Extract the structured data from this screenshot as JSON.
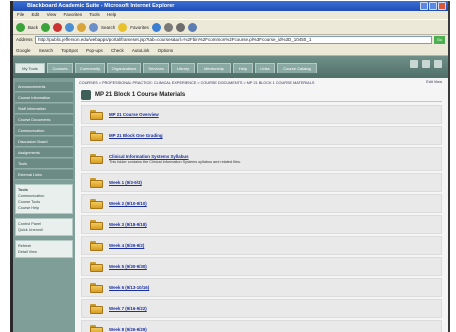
{
  "window": {
    "title": "Blackboard Academic Suite - Microsoft Internet Explorer"
  },
  "menu": [
    "File",
    "Edit",
    "View",
    "Favorites",
    "Tools",
    "Help"
  ],
  "toolbar": {
    "back": "Back",
    "search": "Search",
    "favorites": "Favorites"
  },
  "address": {
    "label": "Address",
    "url": "http://public.jefferson.edu/webapps/portal/frameset.jsp?tab=courses&url=%2Fbin%2Fcommon%2Fcourse.pl%3Fcourse_id%3D_10450_1",
    "go": "Go"
  },
  "links": [
    "Google",
    "Search",
    "TopSpot",
    "Pop-ups",
    "Check",
    "AutoLink",
    "Options"
  ],
  "tabs": [
    "My Tools",
    "Courses",
    "Community",
    "Organizations",
    "Services",
    "Library",
    "Mentorship",
    "Help",
    "Links",
    "Course Catalog"
  ],
  "active_tab_index": 0,
  "leftnav": {
    "items": [
      "Announcements",
      "Course Information",
      "Staff Information",
      "Course Documents",
      "Communication",
      "Discussion Board",
      "Assignments",
      "Tools",
      "External Links"
    ],
    "tools_panel": [
      "Tools",
      "Communication",
      "Course Tools",
      "Course Help"
    ],
    "panel2": [
      "Control Panel",
      "Quick Unenroll"
    ],
    "panel3": [
      "Refresh",
      "Detail View"
    ]
  },
  "content": {
    "breadcrumb": "COURSES > PROFESSIONAL PRACTICE: CLINICAL EXPERIENCE > COURSE DOCUMENTS > MP 21 BLOCK 1 COURSE MATERIALS",
    "breadcrumb_right": "Edit View",
    "page_title": "MP 21 Block 1 Course Materials",
    "items": [
      {
        "title": "MP 21 Course Overview",
        "desc": ""
      },
      {
        "title": "MP 21 Block One Grading",
        "desc": ""
      },
      {
        "title": "Clinical Information Systems Syllabus",
        "desc": "This folder contains the Clinical Information Systems syllabus and related files."
      },
      {
        "title": "Week 1 (9/3-9/3)",
        "desc": ""
      },
      {
        "title": "Week 2 (9/10-9/10)",
        "desc": ""
      },
      {
        "title": "Week 3 (9/18-9/18)",
        "desc": ""
      },
      {
        "title": "Week 4 (9/26-9/2)",
        "desc": ""
      },
      {
        "title": "Week 5 (9/30-9/30)",
        "desc": ""
      },
      {
        "title": "Week 6 (9/13-10/16)",
        "desc": ""
      },
      {
        "title": "Week 7 (9/16-9/22)",
        "desc": ""
      },
      {
        "title": "Week 8 (9/26-9/29)",
        "desc": ""
      }
    ]
  },
  "colors": {
    "titlebar": "#1f4eb4",
    "tabs_bg": "#5f7f79",
    "leftnav_bg": "#7f9e98",
    "link": "#1a2fa0",
    "folder": "#e6b23b"
  }
}
